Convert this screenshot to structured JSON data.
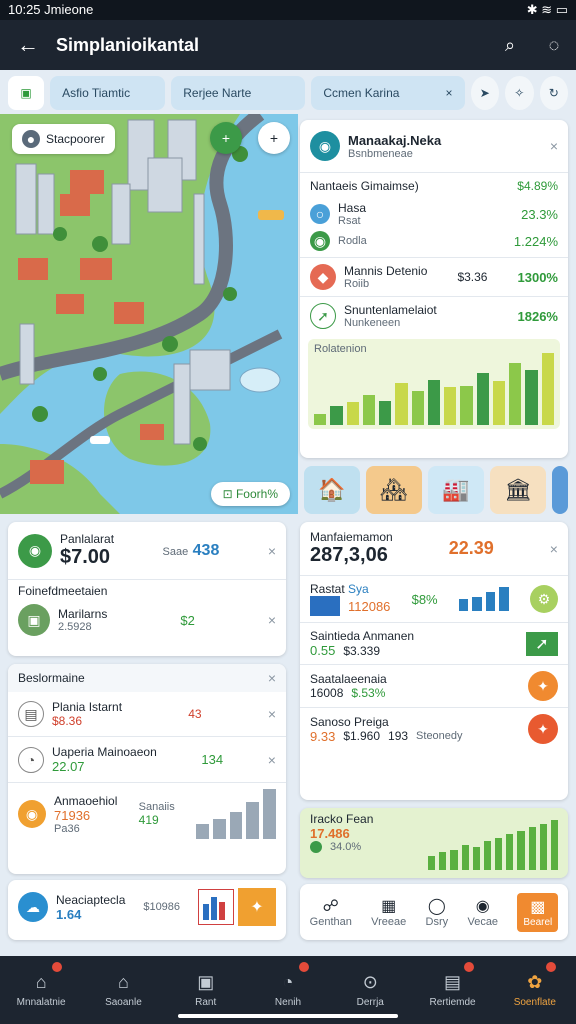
{
  "status": {
    "time": "10:25",
    "carrier": "Jmieone",
    "icons": "✱ ≋ ▭"
  },
  "header": {
    "back": "←",
    "title": "Simplanioikantal",
    "search": "⌕",
    "chat": "◌"
  },
  "chips": [
    "Asfio Tiamtic",
    "Rerjee Narte",
    "Ccmen Karina"
  ],
  "chip_close": "×",
  "map": {
    "label": "Stacpoorer",
    "tag": "Foorh%",
    "tag_icon": "⊡"
  },
  "panel": {
    "title": "Manaakaj.Neka",
    "subtitle": "Bsnbmeneae",
    "close": "×",
    "section": "Nantaeis Gimaimse)",
    "section_value": "$4.89%",
    "rows": [
      {
        "name": "Hasa",
        "sub": "Rsat",
        "value": "23.3%"
      },
      {
        "name": "Rodla",
        "value": "1.224%"
      },
      {
        "name": "Mannis Detenio",
        "sub": "Roiib",
        "mid": "$3.36",
        "value": "1300%"
      },
      {
        "name": "Snuntenlamelaiot",
        "sub": "Nunkeneen",
        "value": "1826%"
      }
    ],
    "chart_title": "Rolatenion"
  },
  "chart_data": {
    "type": "bar",
    "title": "Rolatenion",
    "values": [
      15,
      25,
      30,
      40,
      32,
      55,
      45,
      60,
      50,
      52,
      68,
      58,
      82,
      72,
      95
    ]
  },
  "card1": {
    "title": "Panlalarat",
    "value": "$7.00",
    "badge": "Saae",
    "num": "438",
    "close": "×",
    "section": "Foinefdmeetaien",
    "item": "Marilarns",
    "item_sub": "2.5928",
    "item_val": "$2"
  },
  "card2": {
    "header": "Beslormaine",
    "rows": [
      {
        "name": "Plania Istarnt",
        "a": "$8.36",
        "b": "43"
      },
      {
        "name": "Uaperia Mainoaeon",
        "a": "22.07",
        "b": "134"
      },
      {
        "name": "Anmaoehiol",
        "a": "71936",
        "b": "Sanaiis",
        "c": "Pa36",
        "d": "419"
      }
    ]
  },
  "card3": {
    "name": "Neaciaptecla",
    "value": "1.64",
    "sub": "$10986"
  },
  "right1": {
    "title": "Manfaiemamon",
    "value": "287,3,06",
    "alt": "22.39",
    "rows": [
      {
        "name": "Rastat",
        "tag": "Sya",
        "a": "112086",
        "b": "$8%"
      },
      {
        "name": "Saintieda Anmanen",
        "a": "0.55",
        "b": "$3.339"
      },
      {
        "name": "Saatalaeenaia",
        "a": "16008",
        "b": "$.53%"
      },
      {
        "name": "Sanoso Preiga",
        "a": "9.33",
        "b": "$1.960",
        "c": "193",
        "d": "Steonedy"
      }
    ]
  },
  "right2": {
    "title": "Iracko Fean",
    "value": "17.486",
    "sub": "34.0%"
  },
  "right2_chart": [
    20,
    25,
    28,
    35,
    32,
    40,
    45,
    50,
    55,
    60,
    65,
    70
  ],
  "tools": [
    "Genthan",
    "Vreeae",
    "Dsry",
    "Vecae",
    "Bearel"
  ],
  "nav": [
    {
      "label": "Mnnalatnie",
      "icon": "⌂",
      "dot": true
    },
    {
      "label": "Saoanle",
      "icon": "⌂",
      "dot": false
    },
    {
      "label": "Rant",
      "icon": "▣",
      "dot": false
    },
    {
      "label": "Nenih",
      "icon": "◔",
      "dot": true
    },
    {
      "label": "Derrja",
      "icon": "⊙",
      "dot": false
    },
    {
      "label": "Rertiemde",
      "icon": "▤",
      "dot": true
    },
    {
      "label": "Soenflate",
      "icon": "✿",
      "dot": true
    }
  ]
}
